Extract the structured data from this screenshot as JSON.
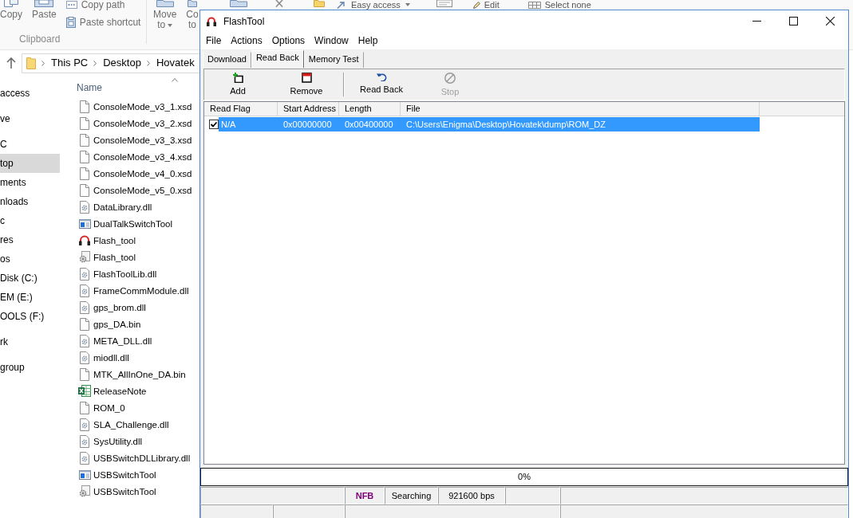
{
  "explorer": {
    "ribbon": {
      "clipboard": {
        "large_buttons": [
          "Copy",
          "Paste"
        ],
        "small_buttons": [
          "Copy path",
          "Paste shortcut"
        ],
        "group_label": "Clipboard"
      },
      "organize_buttons": [
        {
          "lines": [
            "Move",
            "to"
          ],
          "dropdown": true
        },
        {
          "lines": [
            "Co",
            "to"
          ],
          "dropdown": false
        }
      ],
      "top_strip": [
        {
          "label": "Easy access",
          "dropdown": true
        },
        {
          "label": "Edit",
          "dropdown": false
        },
        {
          "label": "Select none",
          "dropdown": false
        }
      ]
    },
    "address_bar": {
      "crumbs": [
        "This PC",
        "Desktop",
        "Hovatek"
      ]
    },
    "navigation_pane": {
      "groups": [
        {
          "items": [
            {
              "label": "access",
              "selected": false
            }
          ]
        },
        {
          "items": [
            {
              "label": "ve",
              "selected": false
            }
          ]
        },
        {
          "items": [
            {
              "label": "C",
              "selected": false
            },
            {
              "label": "top",
              "selected": true
            },
            {
              "label": "ments",
              "selected": false
            },
            {
              "label": "nloads",
              "selected": false
            },
            {
              "label": "c",
              "selected": false
            },
            {
              "label": "res",
              "selected": false
            },
            {
              "label": "os",
              "selected": false
            },
            {
              "label": "Disk (C:)",
              "selected": false
            },
            {
              "label": "EM (E:)",
              "selected": false
            },
            {
              "label": "OOLS (F:)",
              "selected": false
            }
          ]
        },
        {
          "items": [
            {
              "label": "rk",
              "selected": false
            }
          ]
        },
        {
          "items": [
            {
              "label": "group",
              "selected": false
            }
          ]
        }
      ]
    },
    "file_list": {
      "column": "Name",
      "files": [
        {
          "name": "ConsoleMode_v3_1.xsd",
          "kind": "file"
        },
        {
          "name": "ConsoleMode_v3_2.xsd",
          "kind": "file"
        },
        {
          "name": "ConsoleMode_v3_3.xsd",
          "kind": "file"
        },
        {
          "name": "ConsoleMode_v3_4.xsd",
          "kind": "file"
        },
        {
          "name": "ConsoleMode_v4_0.xsd",
          "kind": "file"
        },
        {
          "name": "ConsoleMode_v5_0.xsd",
          "kind": "file"
        },
        {
          "name": "DataLibrary.dll",
          "kind": "dll"
        },
        {
          "name": "DualTalkSwitchTool",
          "kind": "app"
        },
        {
          "name": "Flash_tool",
          "kind": "flash"
        },
        {
          "name": "Flash_tool",
          "kind": "exe"
        },
        {
          "name": "FlashToolLib.dll",
          "kind": "dll"
        },
        {
          "name": "FrameCommModule.dll",
          "kind": "dll"
        },
        {
          "name": "gps_brom.dll",
          "kind": "dll"
        },
        {
          "name": "gps_DA.bin",
          "kind": "file"
        },
        {
          "name": "META_DLL.dll",
          "kind": "dll"
        },
        {
          "name": "miodll.dll",
          "kind": "dll"
        },
        {
          "name": "MTK_AllInOne_DA.bin",
          "kind": "file"
        },
        {
          "name": "ReleaseNote",
          "kind": "excel"
        },
        {
          "name": "ROM_0",
          "kind": "file"
        },
        {
          "name": "SLA_Challenge.dll",
          "kind": "dll"
        },
        {
          "name": "SysUtility.dll",
          "kind": "dll"
        },
        {
          "name": "USBSwitchDLLibrary.dll",
          "kind": "dll"
        },
        {
          "name": "USBSwitchTool",
          "kind": "app"
        },
        {
          "name": "USBSwitchTool",
          "kind": "exe"
        }
      ]
    }
  },
  "flashtool": {
    "window": {
      "title": "FlashTool"
    },
    "menu": [
      "File",
      "Actions",
      "Options",
      "Window",
      "Help"
    ],
    "tabs": [
      {
        "label": "Download",
        "selected": false
      },
      {
        "label": "Read Back",
        "selected": true
      },
      {
        "label": "Memory Test",
        "selected": false
      }
    ],
    "toolbar": [
      {
        "kind": "add",
        "label": "Add",
        "disabled": false
      },
      {
        "kind": "remove",
        "label": "Remove",
        "disabled": false
      },
      {
        "kind": "separator"
      },
      {
        "kind": "read-back",
        "label": "Read Back",
        "disabled": false
      },
      {
        "kind": "stop",
        "label": "Stop",
        "disabled": true
      }
    ],
    "table": {
      "columns": [
        "Read Flag",
        "Start Address",
        "Length",
        "File"
      ],
      "rows": [
        {
          "checked": true,
          "selected": true,
          "cells": [
            "N/A",
            "0x00000000",
            "0x00400000",
            "C:\\Users\\Enigma\\Desktop\\Hovatek\\dump\\ROM_DZ"
          ]
        }
      ]
    },
    "progress": {
      "label": "0%",
      "level": 0
    },
    "status_bar": {
      "rows": [
        [
          {
            "kind": "blank"
          },
          {
            "kind": "text",
            "text": "NFB",
            "color": "#800080",
            "bold": true
          },
          {
            "kind": "text",
            "text": "Searching",
            "color": "#000000",
            "bold": false
          },
          {
            "kind": "text",
            "text": "921600 bps",
            "color": "#000000",
            "bold": false
          },
          {
            "kind": "blank"
          },
          {
            "kind": "blank"
          }
        ],
        [
          {
            "kind": "blank"
          },
          {
            "kind": "blank"
          },
          {
            "kind": "blank"
          },
          {
            "kind": "blank"
          }
        ]
      ]
    }
  }
}
